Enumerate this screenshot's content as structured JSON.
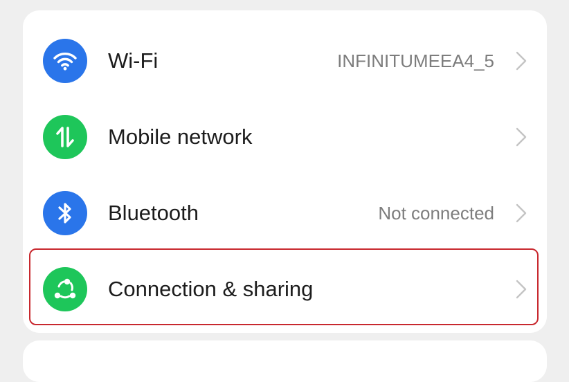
{
  "settings": {
    "items": [
      {
        "label": "Wi-Fi",
        "value": "INFINITUMEEA4_5",
        "icon": "wifi-icon",
        "icon_color": "#2a75ea"
      },
      {
        "label": "Mobile network",
        "value": "",
        "icon": "mobile-data-icon",
        "icon_color": "#1ec65a"
      },
      {
        "label": "Bluetooth",
        "value": "Not connected",
        "icon": "bluetooth-icon",
        "icon_color": "#2a75ea"
      },
      {
        "label": "Connection & sharing",
        "value": "",
        "icon": "connection-sharing-icon",
        "icon_color": "#1ec65a"
      }
    ]
  },
  "colors": {
    "highlight_border": "#c8282e",
    "background": "#efefef"
  }
}
